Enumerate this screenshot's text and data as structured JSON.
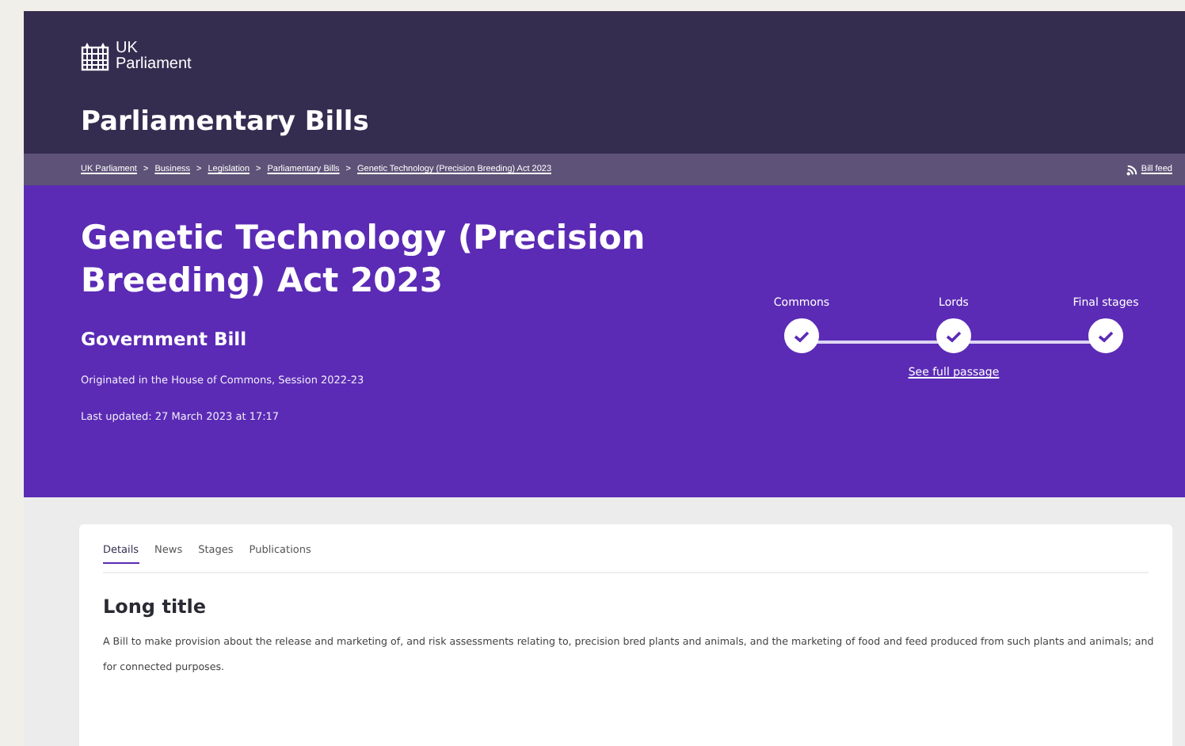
{
  "header": {
    "logo": {
      "line_1": "UK",
      "line_2": "Parliament"
    },
    "site_title": "Parliamentary Bills"
  },
  "breadcrumb": {
    "items": [
      "UK Parliament",
      "Business",
      "Legislation",
      "Parliamentary Bills",
      "Genetic Technology (Precision Breeding) Act 2023"
    ],
    "separator": ">",
    "feed_link": "Bill feed"
  },
  "bill": {
    "title": "Genetic Technology (Precision Breeding) Act 2023",
    "type": "Government Bill",
    "origin": "Originated in the House of Commons, Session 2022-23",
    "updated": "Last updated: 27 March 2023 at 17:17",
    "stages": [
      {
        "label": "Commons",
        "completed": true
      },
      {
        "label": "Lords",
        "completed": true
      },
      {
        "label": "Final stages",
        "completed": true
      }
    ],
    "passage_link": "See full passage"
  },
  "tabs": [
    {
      "label": "Details",
      "selected": true
    },
    {
      "label": "News",
      "selected": false
    },
    {
      "label": "Stages",
      "selected": false
    },
    {
      "label": "Publications",
      "selected": false
    }
  ],
  "section": {
    "heading": "Long title",
    "text": "A Bill to make provision about the release and marketing of, and risk assessments relating to, precision bred plants and animals, and the marketing of food and feed produced from such plants and animals; and for connected purposes."
  }
}
